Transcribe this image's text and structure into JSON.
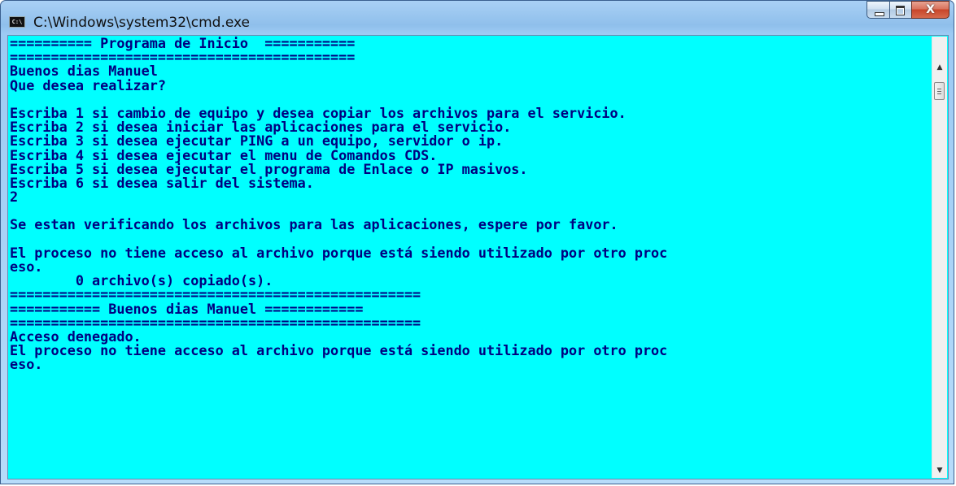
{
  "window": {
    "title": "C:\\Windows\\system32\\cmd.exe",
    "icon_label": "C:\\"
  },
  "colors": {
    "console_background": "#00ffff",
    "console_text": "#000080"
  },
  "console": {
    "lines": [
      "========== Programa de Inicio  ===========",
      "==========================================",
      "Buenos dias Manuel",
      "Que desea realizar?",
      "",
      "Escriba 1 si cambio de equipo y desea copiar los archivos para el servicio.",
      "Escriba 2 si desea iniciar las aplicaciones para el servicio.",
      "Escriba 3 si desea ejecutar PING a un equipo, servidor o ip.",
      "Escriba 4 si desea ejecutar el menu de Comandos CDS.",
      "Escriba 5 si desea ejecutar el programa de Enlace o IP masivos.",
      "Escriba 6 si desea salir del sistema.",
      "2",
      "",
      "Se estan verificando los archivos para las aplicaciones, espere por favor.",
      "",
      "El proceso no tiene acceso al archivo porque está siendo utilizado por otro proc",
      "eso.",
      "        0 archivo(s) copiado(s).",
      "==================================================",
      "=========== Buenos dias Manuel ============",
      "==================================================",
      "Acceso denegado.",
      "El proceso no tiene acceso al archivo porque está siendo utilizado por otro proc",
      "eso."
    ]
  },
  "scrollbar": {
    "up_icon": "arrow-up-icon",
    "down_icon": "arrow-down-icon"
  }
}
